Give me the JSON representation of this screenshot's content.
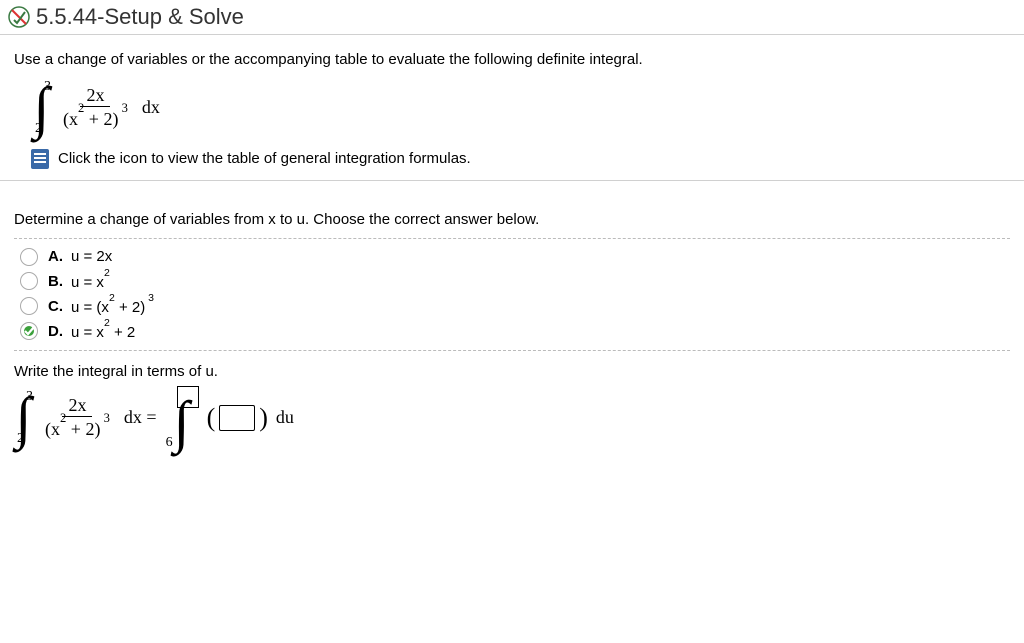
{
  "header": {
    "title": "5.5.44-Setup & Solve"
  },
  "prompt": "Use a change of variables or the accompanying table to evaluate the following definite integral.",
  "integral": {
    "upper": "3",
    "lower": "2",
    "numerator": "2x",
    "denominator": "(x² + 2)³",
    "dx": "dx"
  },
  "tableLink": "Click the icon to view the table of general integration formulas.",
  "question2": "Determine a change of variables from x to u. Choose the correct answer below.",
  "options": {
    "A": {
      "letter": "A.",
      "text": "u = 2x",
      "selected": false
    },
    "B": {
      "letter": "B.",
      "text": "u = x²",
      "selected": false
    },
    "C": {
      "letter": "C.",
      "text": "u = (x² + 2)³",
      "selected": false
    },
    "D": {
      "letter": "D.",
      "text": "u = x² + 2",
      "selected": true
    }
  },
  "writeIntegral": "Write the integral in terms of u.",
  "resultIntegral": {
    "upper": "3",
    "lower": "2",
    "numerator": "2x",
    "denominator": "(x² + 2)³",
    "dx_eq": "dx =",
    "rhs_lower": "6",
    "du": "du"
  }
}
